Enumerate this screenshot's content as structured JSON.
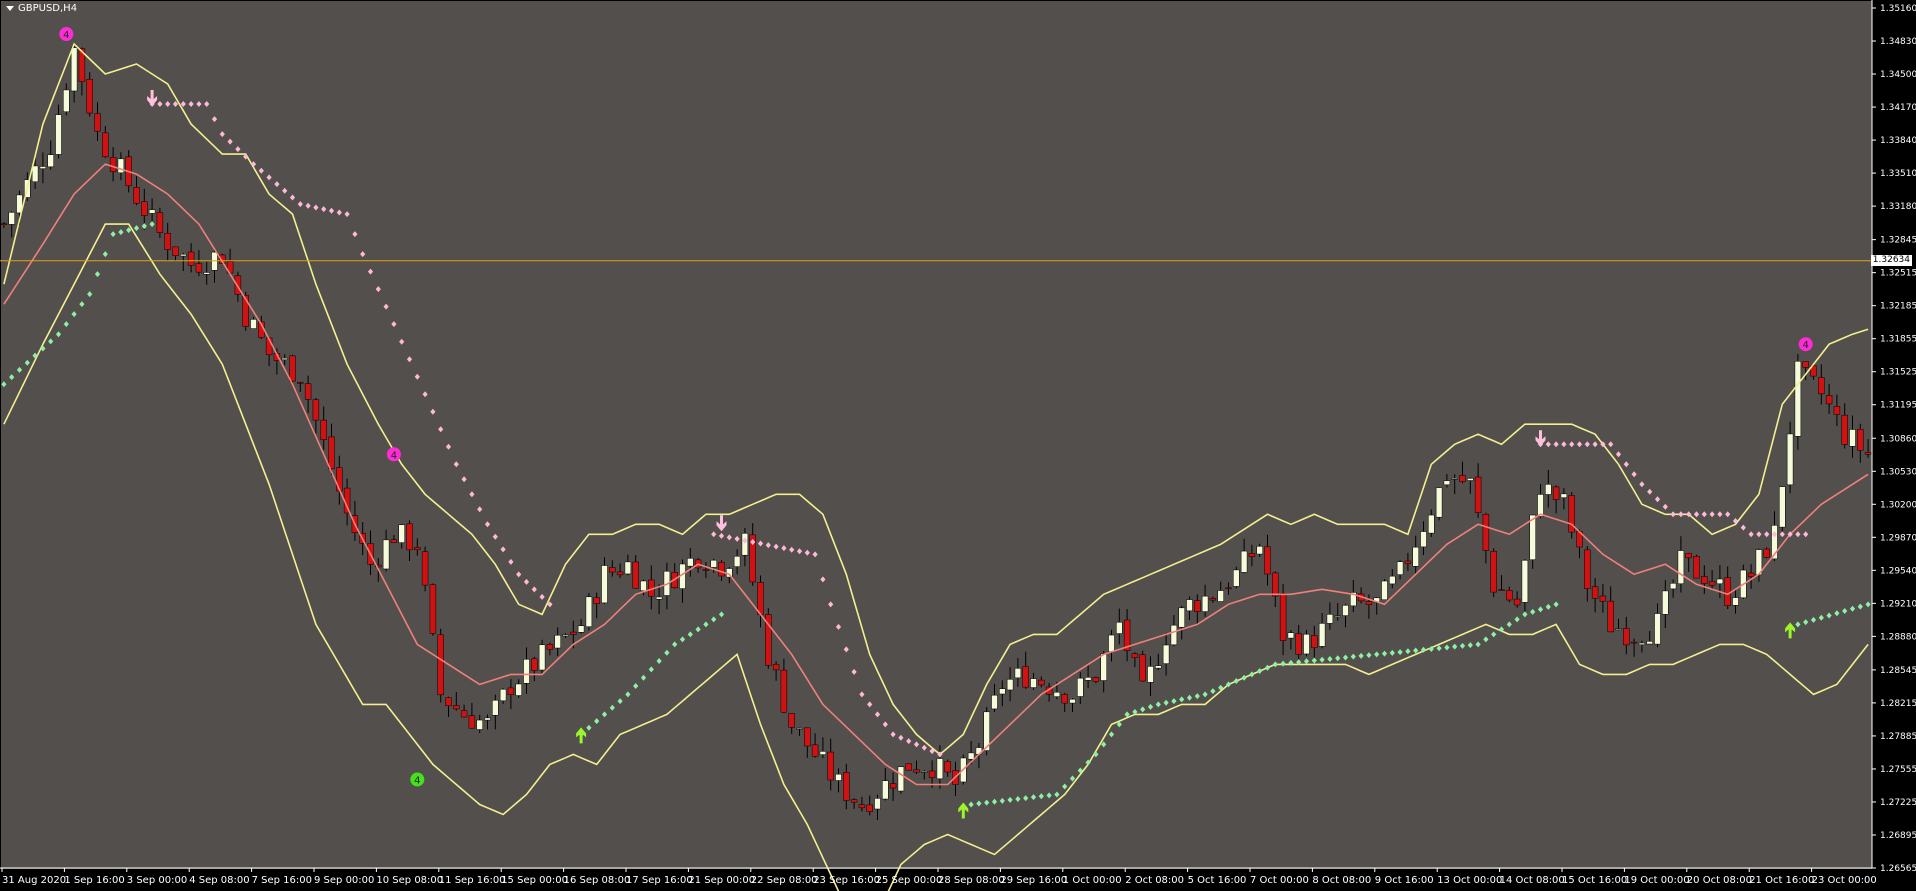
{
  "symbol": "GBPUSD,H4",
  "colors": {
    "background": "#524f4d",
    "axis_bg": "#000000",
    "axis_text": "#ffffff",
    "bull_candle": "#f6fbd9",
    "bear_candle": "#d11212",
    "wick": "#000000",
    "bollinger_band": "#f4ef8f",
    "middle_line": "#f0807a",
    "hline": "#e0a412",
    "dots_down": "#ffb8d8",
    "dots_up": "#8ef0a4",
    "arrow_up": "#9cf52a",
    "arrow_down": "#ffc0dc",
    "marker_magenta": "#ff2bd6",
    "marker_green": "#46e01c"
  },
  "chart_data": {
    "type": "candlestick",
    "ylim": [
      1.26565,
      1.3516
    ],
    "y_ticks": [
      "1.35160",
      "1.34830",
      "1.34500",
      "1.34170",
      "1.33840",
      "1.33510",
      "1.33180",
      "1.32845",
      "1.32515",
      "1.32185",
      "1.31855",
      "1.31525",
      "1.31195",
      "1.30860",
      "1.30530",
      "1.30200",
      "1.29870",
      "1.29540",
      "1.29210",
      "1.28880",
      "1.28545",
      "1.28215",
      "1.27885",
      "1.27555",
      "1.27225",
      "1.26895",
      "1.26565"
    ],
    "x_ticks": [
      "31 Aug 2020",
      "1 Sep 16:00",
      "3 Sep 00:00",
      "4 Sep 08:00",
      "7 Sep 16:00",
      "9 Sep 00:00",
      "10 Sep 08:00",
      "11 Sep 16:00",
      "15 Sep 00:00",
      "16 Sep 08:00",
      "17 Sep 16:00",
      "21 Sep 00:00",
      "22 Sep 08:00",
      "23 Sep 16:00",
      "25 Sep 00:00",
      "28 Sep 08:00",
      "29 Sep 16:00",
      "1 Oct 00:00",
      "2 Oct 08:00",
      "5 Oct 16:00",
      "7 Oct 00:00",
      "8 Oct 08:00",
      "9 Oct 16:00",
      "13 Oct 00:00",
      "14 Oct 08:00",
      "15 Oct 16:00",
      "19 Oct 00:00",
      "20 Oct 08:00",
      "21 Oct 16:00",
      "23 Oct 00:00"
    ],
    "current_price": "1.32634",
    "close_path": [
      [
        0,
        1.33
      ],
      [
        6,
        1.338
      ],
      [
        9,
        1.3475
      ],
      [
        12,
        1.339
      ],
      [
        16,
        1.334
      ],
      [
        20,
        1.329
      ],
      [
        24,
        1.326
      ],
      [
        28,
        1.327
      ],
      [
        31,
        1.321
      ],
      [
        34,
        1.317
      ],
      [
        38,
        1.315
      ],
      [
        41,
        1.308
      ],
      [
        44,
        1.301
      ],
      [
        47,
        1.296
      ],
      [
        50,
        1.299
      ],
      [
        53,
        1.298
      ],
      [
        56,
        1.283
      ],
      [
        59,
        1.281
      ],
      [
        62,
        1.28
      ],
      [
        65,
        1.284
      ],
      [
        68,
        1.286
      ],
      [
        71,
        1.288
      ],
      [
        74,
        1.29
      ],
      [
        77,
        1.295
      ],
      [
        80,
        1.296
      ],
      [
        83,
        1.293
      ],
      [
        86,
        1.295
      ],
      [
        89,
        1.297
      ],
      [
        92,
        1.296
      ],
      [
        95,
        1.298
      ],
      [
        98,
        1.287
      ],
      [
        101,
        1.28
      ],
      [
        104,
        1.277
      ],
      [
        107,
        1.274
      ],
      [
        110,
        1.272
      ],
      [
        113,
        1.274
      ],
      [
        116,
        1.276
      ],
      [
        119,
        1.276
      ],
      [
        122,
        1.274
      ],
      [
        125,
        1.278
      ],
      [
        128,
        1.284
      ],
      [
        131,
        1.285
      ],
      [
        134,
        1.284
      ],
      [
        137,
        1.283
      ],
      [
        140,
        1.285
      ],
      [
        143,
        1.29
      ],
      [
        146,
        1.283
      ],
      [
        149,
        1.289
      ],
      [
        152,
        1.292
      ],
      [
        155,
        1.293
      ],
      [
        158,
        1.295
      ],
      [
        161,
        1.298
      ],
      [
        164,
        1.289
      ],
      [
        167,
        1.288
      ],
      [
        170,
        1.29
      ],
      [
        173,
        1.292
      ],
      [
        176,
        1.292
      ],
      [
        179,
        1.295
      ],
      [
        182,
        1.3
      ],
      [
        185,
        1.305
      ],
      [
        188,
        1.304
      ],
      [
        191,
        1.294
      ],
      [
        194,
        1.292
      ],
      [
        197,
        1.304
      ],
      [
        200,
        1.302
      ],
      [
        203,
        1.294
      ],
      [
        206,
        1.29
      ],
      [
        209,
        1.289
      ],
      [
        212,
        1.29
      ],
      [
        215,
        1.296
      ],
      [
        218,
        1.295
      ],
      [
        221,
        1.293
      ],
      [
        224,
        1.295
      ],
      [
        227,
        1.299
      ],
      [
        230,
        1.315
      ],
      [
        233,
        1.313
      ],
      [
        236,
        1.309
      ],
      [
        239,
        1.307
      ]
    ],
    "bollinger_upper_path": [
      [
        0,
        1.324
      ],
      [
        5,
        1.34
      ],
      [
        9,
        1.348
      ],
      [
        13,
        1.345
      ],
      [
        17,
        1.346
      ],
      [
        21,
        1.344
      ],
      [
        24,
        1.34
      ],
      [
        28,
        1.337
      ],
      [
        31,
        1.337
      ],
      [
        34,
        1.333
      ],
      [
        37,
        1.331
      ],
      [
        40,
        1.324
      ],
      [
        44,
        1.316
      ],
      [
        48,
        1.31
      ],
      [
        51,
        1.306
      ],
      [
        54,
        1.303
      ],
      [
        57,
        1.301
      ],
      [
        60,
        1.299
      ],
      [
        63,
        1.296
      ],
      [
        66,
        1.292
      ],
      [
        69,
        1.291
      ],
      [
        72,
        1.296
      ],
      [
        75,
        1.299
      ],
      [
        78,
        1.299
      ],
      [
        81,
        1.3
      ],
      [
        84,
        1.3
      ],
      [
        87,
        1.299
      ],
      [
        90,
        1.301
      ],
      [
        93,
        1.301
      ],
      [
        96,
        1.302
      ],
      [
        99,
        1.303
      ],
      [
        102,
        1.303
      ],
      [
        105,
        1.301
      ],
      [
        108,
        1.295
      ],
      [
        111,
        1.287
      ],
      [
        114,
        1.282
      ],
      [
        117,
        1.279
      ],
      [
        120,
        1.277
      ],
      [
        123,
        1.279
      ],
      [
        126,
        1.284
      ],
      [
        129,
        1.288
      ],
      [
        132,
        1.289
      ],
      [
        135,
        1.289
      ],
      [
        138,
        1.291
      ],
      [
        141,
        1.293
      ],
      [
        144,
        1.294
      ],
      [
        147,
        1.295
      ],
      [
        150,
        1.296
      ],
      [
        153,
        1.297
      ],
      [
        156,
        1.298
      ],
      [
        159,
        1.2995
      ],
      [
        162,
        1.301
      ],
      [
        165,
        1.3
      ],
      [
        168,
        1.301
      ],
      [
        171,
        1.3
      ],
      [
        174,
        1.3
      ],
      [
        177,
        1.3
      ],
      [
        180,
        1.299
      ],
      [
        183,
        1.306
      ],
      [
        186,
        1.308
      ],
      [
        189,
        1.309
      ],
      [
        192,
        1.308
      ],
      [
        195,
        1.31
      ],
      [
        198,
        1.31
      ],
      [
        201,
        1.31
      ],
      [
        204,
        1.309
      ],
      [
        207,
        1.306
      ],
      [
        210,
        1.302
      ],
      [
        213,
        1.301
      ],
      [
        216,
        1.301
      ],
      [
        219,
        1.299
      ],
      [
        222,
        1.3
      ],
      [
        225,
        1.303
      ],
      [
        228,
        1.312
      ],
      [
        231,
        1.315
      ],
      [
        234,
        1.318
      ],
      [
        237,
        1.319
      ],
      [
        239,
        1.3195
      ]
    ],
    "bollinger_lower_path": [
      [
        0,
        1.31
      ],
      [
        5,
        1.318
      ],
      [
        9,
        1.324
      ],
      [
        13,
        1.33
      ],
      [
        16,
        1.33
      ],
      [
        20,
        1.325
      ],
      [
        24,
        1.321
      ],
      [
        28,
        1.316
      ],
      [
        31,
        1.31
      ],
      [
        34,
        1.304
      ],
      [
        37,
        1.297
      ],
      [
        40,
        1.29
      ],
      [
        43,
        1.286
      ],
      [
        46,
        1.282
      ],
      [
        49,
        1.282
      ],
      [
        52,
        1.279
      ],
      [
        55,
        1.276
      ],
      [
        58,
        1.274
      ],
      [
        61,
        1.272
      ],
      [
        64,
        1.271
      ],
      [
        67,
        1.273
      ],
      [
        70,
        1.276
      ],
      [
        73,
        1.277
      ],
      [
        76,
        1.276
      ],
      [
        79,
        1.279
      ],
      [
        82,
        1.28
      ],
      [
        85,
        1.281
      ],
      [
        88,
        1.283
      ],
      [
        91,
        1.285
      ],
      [
        94,
        1.287
      ],
      [
        97,
        1.28
      ],
      [
        100,
        1.274
      ],
      [
        103,
        1.27
      ],
      [
        106,
        1.265
      ],
      [
        109,
        1.26
      ],
      [
        112,
        1.261
      ],
      [
        115,
        1.266
      ],
      [
        118,
        1.268
      ],
      [
        121,
        1.269
      ],
      [
        124,
        1.268
      ],
      [
        127,
        1.267
      ],
      [
        130,
        1.269
      ],
      [
        133,
        1.271
      ],
      [
        136,
        1.273
      ],
      [
        139,
        1.276
      ],
      [
        142,
        1.28
      ],
      [
        145,
        1.281
      ],
      [
        148,
        1.281
      ],
      [
        151,
        1.282
      ],
      [
        154,
        1.282
      ],
      [
        157,
        1.284
      ],
      [
        160,
        1.285
      ],
      [
        163,
        1.286
      ],
      [
        166,
        1.286
      ],
      [
        169,
        1.286
      ],
      [
        172,
        1.286
      ],
      [
        175,
        1.285
      ],
      [
        178,
        1.286
      ],
      [
        181,
        1.287
      ],
      [
        184,
        1.288
      ],
      [
        187,
        1.289
      ],
      [
        190,
        1.29
      ],
      [
        193,
        1.289
      ],
      [
        196,
        1.289
      ],
      [
        199,
        1.29
      ],
      [
        202,
        1.286
      ],
      [
        205,
        1.285
      ],
      [
        208,
        1.285
      ],
      [
        211,
        1.286
      ],
      [
        214,
        1.286
      ],
      [
        217,
        1.287
      ],
      [
        220,
        1.288
      ],
      [
        223,
        1.288
      ],
      [
        226,
        1.287
      ],
      [
        229,
        1.285
      ],
      [
        232,
        1.283
      ],
      [
        235,
        1.284
      ],
      [
        239,
        1.288
      ]
    ],
    "middle_line_path": [
      [
        0,
        1.322
      ],
      [
        5,
        1.328
      ],
      [
        9,
        1.333
      ],
      [
        13,
        1.336
      ],
      [
        17,
        1.335
      ],
      [
        21,
        1.333
      ],
      [
        25,
        1.33
      ],
      [
        29,
        1.325
      ],
      [
        33,
        1.32
      ],
      [
        37,
        1.314
      ],
      [
        41,
        1.307
      ],
      [
        45,
        1.3
      ],
      [
        49,
        1.294
      ],
      [
        53,
        1.288
      ],
      [
        57,
        1.286
      ],
      [
        61,
        1.284
      ],
      [
        65,
        1.285
      ],
      [
        69,
        1.285
      ],
      [
        73,
        1.288
      ],
      [
        77,
        1.29
      ],
      [
        81,
        1.293
      ],
      [
        85,
        1.294
      ],
      [
        89,
        1.296
      ],
      [
        93,
        1.295
      ],
      [
        97,
        1.291
      ],
      [
        101,
        1.287
      ],
      [
        105,
        1.282
      ],
      [
        109,
        1.279
      ],
      [
        113,
        1.276
      ],
      [
        117,
        1.274
      ],
      [
        121,
        1.274
      ],
      [
        125,
        1.277
      ],
      [
        129,
        1.28
      ],
      [
        133,
        1.283
      ],
      [
        137,
        1.285
      ],
      [
        141,
        1.287
      ],
      [
        145,
        1.288
      ],
      [
        149,
        1.289
      ],
      [
        153,
        1.29
      ],
      [
        157,
        1.292
      ],
      [
        161,
        1.293
      ],
      [
        165,
        1.293
      ],
      [
        169,
        1.2935
      ],
      [
        173,
        1.293
      ],
      [
        177,
        1.292
      ],
      [
        181,
        1.295
      ],
      [
        185,
        1.298
      ],
      [
        189,
        1.3
      ],
      [
        193,
        1.299
      ],
      [
        197,
        1.301
      ],
      [
        201,
        1.3
      ],
      [
        205,
        1.297
      ],
      [
        209,
        1.295
      ],
      [
        213,
        1.296
      ],
      [
        217,
        1.294
      ],
      [
        221,
        1.293
      ],
      [
        225,
        1.295
      ],
      [
        229,
        1.299
      ],
      [
        233,
        1.302
      ],
      [
        237,
        1.304
      ],
      [
        239,
        1.305
      ]
    ],
    "dots_down_segments": [
      [
        [
          19,
          1.342
        ],
        [
          26,
          1.342
        ],
        [
          28,
          1.339
        ],
        [
          32,
          1.336
        ],
        [
          38,
          1.332
        ],
        [
          44,
          1.331
        ],
        [
          46,
          1.327
        ],
        [
          50,
          1.32
        ],
        [
          54,
          1.313
        ],
        [
          58,
          1.306
        ],
        [
          62,
          1.3
        ],
        [
          66,
          1.295
        ],
        [
          70,
          1.292
        ]
      ],
      [
        [
          91,
          1.299
        ],
        [
          104,
          1.297
        ],
        [
          106,
          1.292
        ],
        [
          110,
          1.283
        ],
        [
          114,
          1.279
        ],
        [
          120,
          1.277
        ]
      ],
      [
        [
          197,
          1.308
        ],
        [
          206,
          1.308
        ],
        [
          210,
          1.304
        ],
        [
          214,
          1.301
        ],
        [
          221,
          1.301
        ],
        [
          224,
          1.299
        ],
        [
          231,
          1.299
        ]
      ]
    ],
    "dots_up_segments": [
      [
        [
          0,
          1.314
        ],
        [
          7,
          1.319
        ],
        [
          11,
          1.323
        ],
        [
          14,
          1.329
        ],
        [
          19,
          1.33
        ]
      ],
      [
        [
          74,
          1.279
        ],
        [
          80,
          1.283
        ],
        [
          86,
          1.288
        ],
        [
          92,
          1.291
        ]
      ],
      [
        [
          124,
          1.272
        ],
        [
          135,
          1.273
        ],
        [
          140,
          1.277
        ],
        [
          144,
          1.281
        ],
        [
          148,
          1.282
        ],
        [
          154,
          1.283
        ],
        [
          160,
          1.285
        ],
        [
          163,
          1.286
        ],
        [
          189,
          1.288
        ],
        [
          195,
          1.291
        ],
        [
          199,
          1.292
        ]
      ],
      [
        [
          230,
          1.29
        ],
        [
          239,
          1.292
        ]
      ]
    ],
    "arrows": [
      {
        "dir": "down",
        "i": 19,
        "p": 1.3425
      },
      {
        "dir": "down",
        "i": 92,
        "p": 1.3
      },
      {
        "dir": "down",
        "i": 197,
        "p": 1.3085
      },
      {
        "dir": "up",
        "i": 74,
        "p": 1.279
      },
      {
        "dir": "up",
        "i": 123,
        "p": 1.2715
      },
      {
        "dir": "up",
        "i": 229,
        "p": 1.2895
      }
    ],
    "markers": [
      {
        "label": "4",
        "color": "magenta",
        "i": 8,
        "p": 1.349
      },
      {
        "label": "4",
        "color": "magenta",
        "i": 50,
        "p": 1.307
      },
      {
        "label": "4",
        "color": "green",
        "i": 53,
        "p": 1.2745
      },
      {
        "label": "4",
        "color": "magenta",
        "i": 231,
        "p": 1.318
      }
    ]
  }
}
